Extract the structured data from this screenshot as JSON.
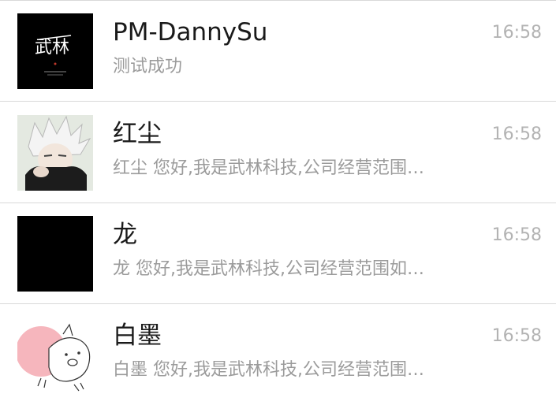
{
  "conversations": [
    {
      "name": "PM-DannySu",
      "preview": "测试成功",
      "time": "16:58",
      "avatar": "wulin-calligraphy-logo",
      "avatar_text": "武林"
    },
    {
      "name": "红尘",
      "preview": "红尘 您好,我是武林科技,公司经营范围…",
      "time": "16:58",
      "avatar": "anime-character-white-hair"
    },
    {
      "name": "龙",
      "preview": "龙 您好,我是武林科技,公司经营范围如…",
      "time": "16:58",
      "avatar": "solid-black"
    },
    {
      "name": "白墨",
      "preview": "白墨 您好,我是武林科技,公司经营范围…",
      "time": "16:58",
      "avatar": "cartoon-pig-pink"
    }
  ],
  "colors": {
    "name": "#1a1a1a",
    "preview": "#9b9b9b",
    "time": "#b3b3b3",
    "divider": "#d9d9d9"
  }
}
